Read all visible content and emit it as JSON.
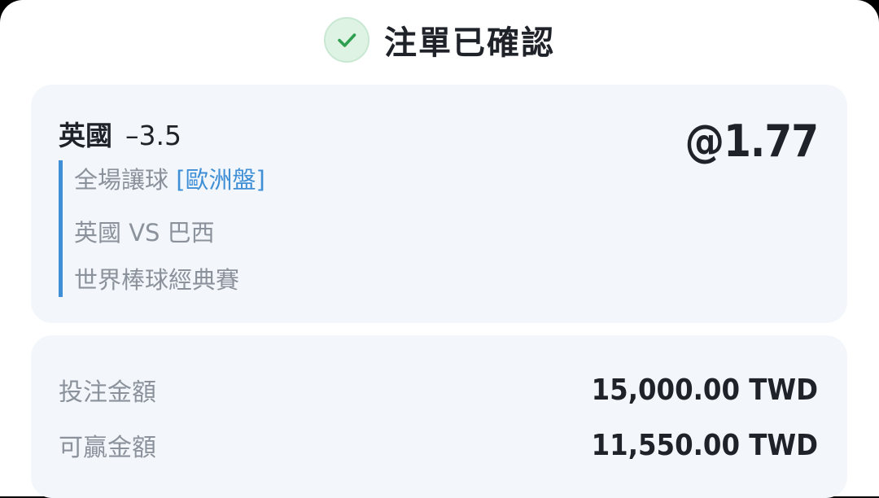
{
  "header": {
    "title": "注單已確認",
    "icon": "check-icon",
    "accent_color": "#2e9e50"
  },
  "bet": {
    "team": "英國",
    "line": "–3.5",
    "odds": "@1.77",
    "market": "全場讓球",
    "market_tag": "[歐洲盤]",
    "matchup": "英國 VS 巴西",
    "league": "世界棒球經典賽",
    "tag_color": "#3f8fd6"
  },
  "amounts": {
    "stake_label": "投注金額",
    "stake_value": "15,000.00 TWD",
    "win_label": "可贏金額",
    "win_value": "11,550.00 TWD"
  }
}
